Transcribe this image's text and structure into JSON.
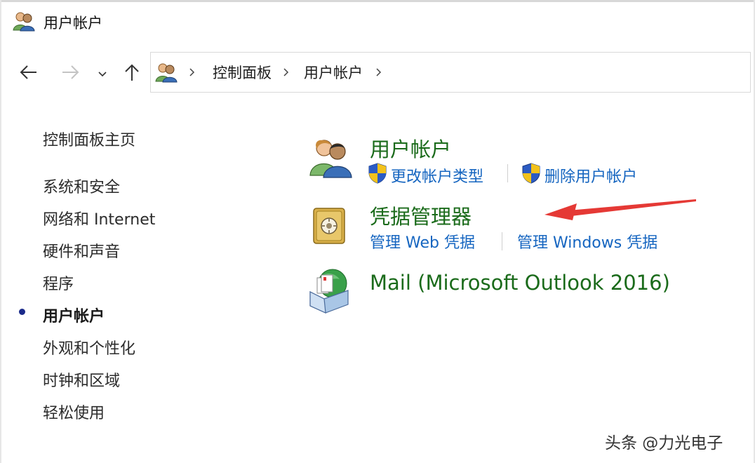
{
  "window": {
    "title": "用户帐户"
  },
  "nav": {
    "back_icon": "arrow-left-icon",
    "forward_icon": "arrow-right-icon",
    "recent_icon": "chevron-down-icon",
    "up_icon": "arrow-up-icon"
  },
  "address": {
    "crumbs": [
      "控制面板",
      "用户帐户"
    ]
  },
  "sidebar": {
    "items": [
      {
        "label": "控制面板主页"
      },
      {
        "label": "系统和安全"
      },
      {
        "label": "网络和 Internet"
      },
      {
        "label": "硬件和声音"
      },
      {
        "label": "程序"
      },
      {
        "label": "用户帐户",
        "active": true
      },
      {
        "label": "外观和个性化"
      },
      {
        "label": "时钟和区域"
      },
      {
        "label": "轻松使用"
      }
    ]
  },
  "categories": [
    {
      "title": "用户帐户",
      "icon": "users-icon",
      "links": [
        "更改帐户类型",
        "删除用户帐户"
      ]
    },
    {
      "title": "凭据管理器",
      "icon": "safe-icon",
      "links": [
        "管理 Web 凭据",
        "管理 Windows 凭据"
      ]
    },
    {
      "title": "Mail (Microsoft Outlook 2016)",
      "icon": "mail-icon",
      "links": []
    }
  ],
  "colors": {
    "category_title": "#1b6b1b",
    "link": "#1565c0",
    "annotation_arrow": "#e53935"
  },
  "watermark": "头条 @力光电子"
}
